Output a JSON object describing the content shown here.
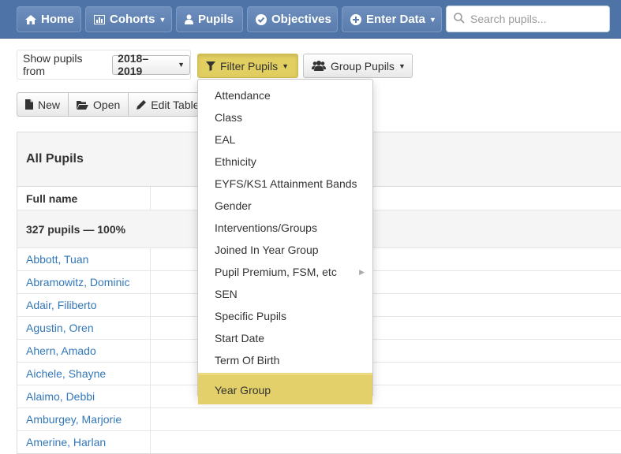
{
  "navbar": {
    "home": "Home",
    "cohorts": "Cohorts",
    "pupils": "Pupils",
    "objectives": "Objectives",
    "enter_data": "Enter Data",
    "search_placeholder": "Search pupils..."
  },
  "filters": {
    "show_label": "Show pupils from",
    "year_value": "2018–2019",
    "filter_label": "Filter Pupils",
    "group_label": "Group Pupils"
  },
  "toolbar": {
    "new_label": "New",
    "open_label": "Open",
    "edit_table_label": "Edit Table"
  },
  "table": {
    "title": "All Pupils",
    "column_full_name": "Full name",
    "summary": "327 pupils — 100%",
    "pupils": [
      "Abbott, Tuan",
      "Abramowitz, Dominic",
      "Adair, Filiberto",
      "Agustin, Oren",
      "Ahern, Amado",
      "Aichele, Shayne",
      "Alaimo, Debbi",
      "Amburgey, Marjorie",
      "Amerine, Harlan"
    ]
  },
  "filter_menu": {
    "items": [
      "Attendance",
      "Class",
      "EAL",
      "Ethnicity",
      "EYFS/KS1 Attainment Bands",
      "Gender",
      "Interventions/Groups",
      "Joined In Year Group",
      "Pupil Premium, FSM, etc",
      "SEN",
      "Specific Pupils",
      "Start Date",
      "Term Of Birth",
      "Year Group"
    ],
    "submenu_item_index": 8,
    "active_item_index": 13
  },
  "colors": {
    "navbar": "#4e73a6",
    "link": "#3377b8",
    "highlight": "#e3d06a"
  }
}
